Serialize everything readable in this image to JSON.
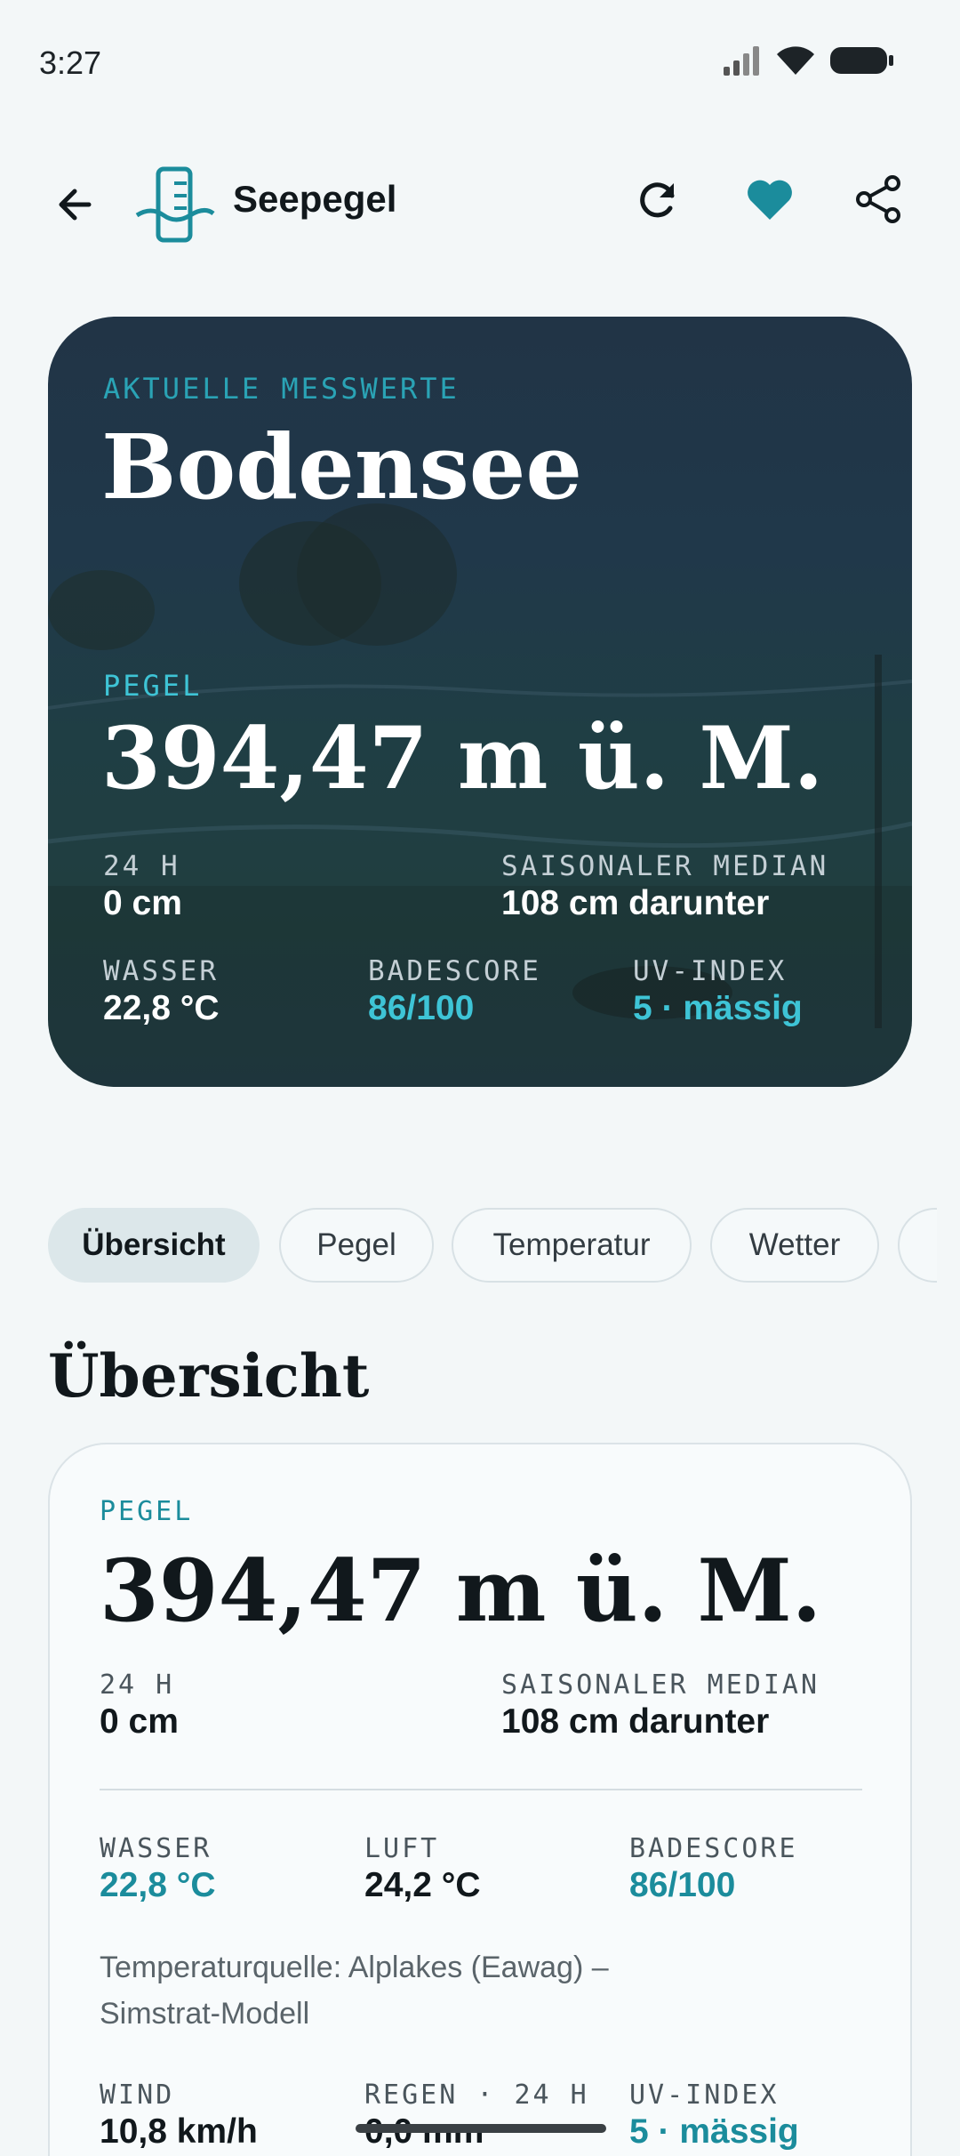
{
  "status": {
    "time": "3:27"
  },
  "appbar": {
    "title": "Seepegel"
  },
  "hero": {
    "kicker": "AKTUELLE MESSWERTE",
    "lake": "Bodensee",
    "pegel_label": "PEGEL",
    "pegel_value": "394,47 m ü. M.",
    "h24_label": "24 H",
    "h24_value": "0 cm",
    "median_label": "SAISONALER MEDIAN",
    "median_value": "108 cm darunter",
    "water_label": "WASSER",
    "water_value": "22,8 °C",
    "score_label": "BADESCORE",
    "score_value": "86/100",
    "uv_label": "UV-INDEX",
    "uv_value": "5 · mässig"
  },
  "tabs": [
    "Übersicht",
    "Pegel",
    "Temperatur",
    "Wetter"
  ],
  "section": {
    "title": "Übersicht"
  },
  "overview": {
    "pegel_label": "PEGEL",
    "pegel_value": "394,47 m ü. M.",
    "h24_label": "24 H",
    "h24_value": "0 cm",
    "median_label": "SAISONALER MEDIAN",
    "median_value": "108 cm darunter",
    "water_label": "WASSER",
    "water_value": "22,8 °C",
    "air_label": "LUFT",
    "air_value": "24,2 °C",
    "score_label": "BADESCORE",
    "score_value": "86/100",
    "source": "Temperaturquelle: Alplakes (Eawag) – Simstrat-Modell",
    "wind_label": "WIND",
    "wind_value": "10,8 km/h",
    "rain_label": "REGEN · 24 H",
    "rain_value": "0,0 mm",
    "uv_label": "UV-INDEX",
    "uv_value": "5 · mässig"
  },
  "colors": {
    "accent": "#1b8c9c",
    "accent_light": "#3ec4d6",
    "hero_bg": "#20384a",
    "page_bg": "#f3f7f8"
  }
}
